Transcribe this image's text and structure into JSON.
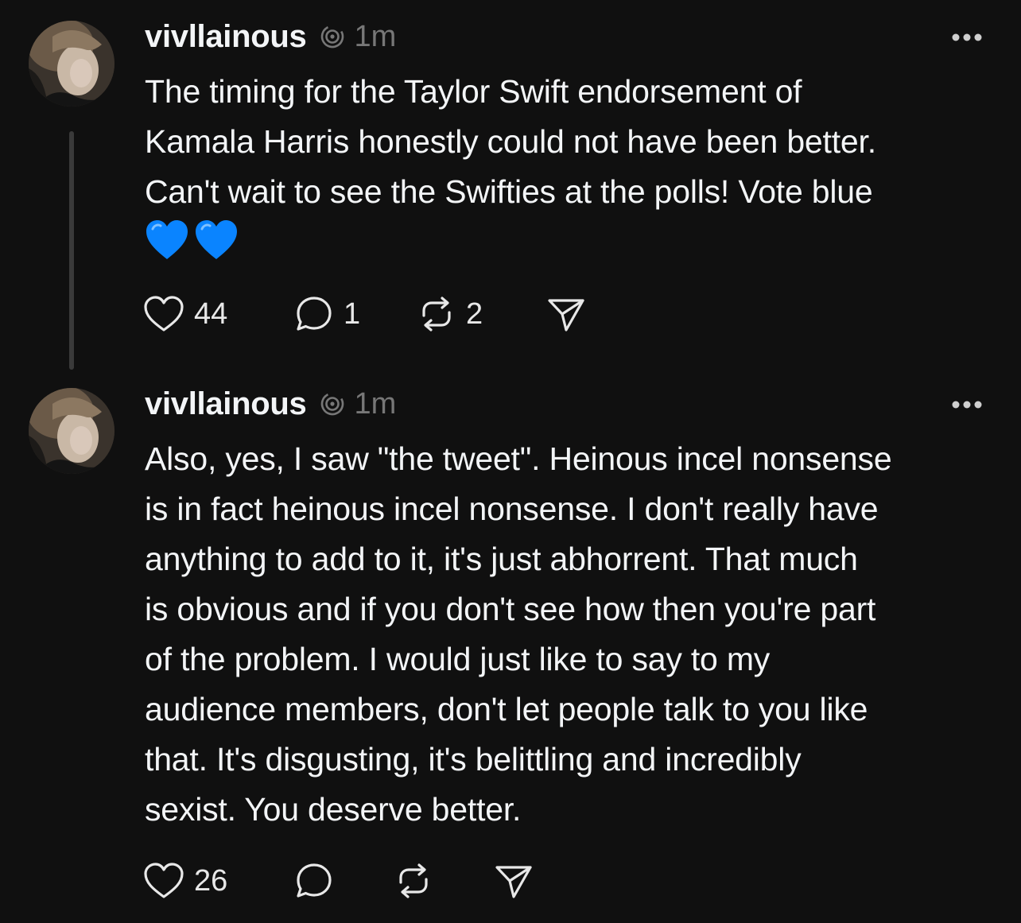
{
  "posts": [
    {
      "username": "vivllainous",
      "time": "1m",
      "text": "The timing for the Taylor Swift endorsement of\nKamala Harris honestly could not have been better.\nCan't wait to see the Swifties at the polls! Vote blue",
      "emoji": [
        "blue-heart-emoji",
        "blue-heart-emoji"
      ],
      "accent_color": "#0a84ff",
      "actions": {
        "like_count": "44",
        "reply_count": "1",
        "repost_count": "2"
      }
    },
    {
      "username": "vivllainous",
      "time": "1m",
      "text": "Also, yes, I saw \"the tweet\". Heinous incel nonsense\nis in fact heinous incel nonsense. I don't really have\nanything to add to it, it's just abhorrent. That much\nis obvious and if you don't see how then you're part\nof the problem. I would just like to say to my\naudience members, don't let people talk to you like\nthat. It's disgusting, it's belittling and incredibly\nsexist. You deserve better.",
      "actions": {
        "like_count": "26"
      }
    }
  ],
  "colors": {
    "background": "#101010",
    "text": "#f3f5f7",
    "muted": "#777777",
    "thread_line": "#3a3a3a"
  }
}
